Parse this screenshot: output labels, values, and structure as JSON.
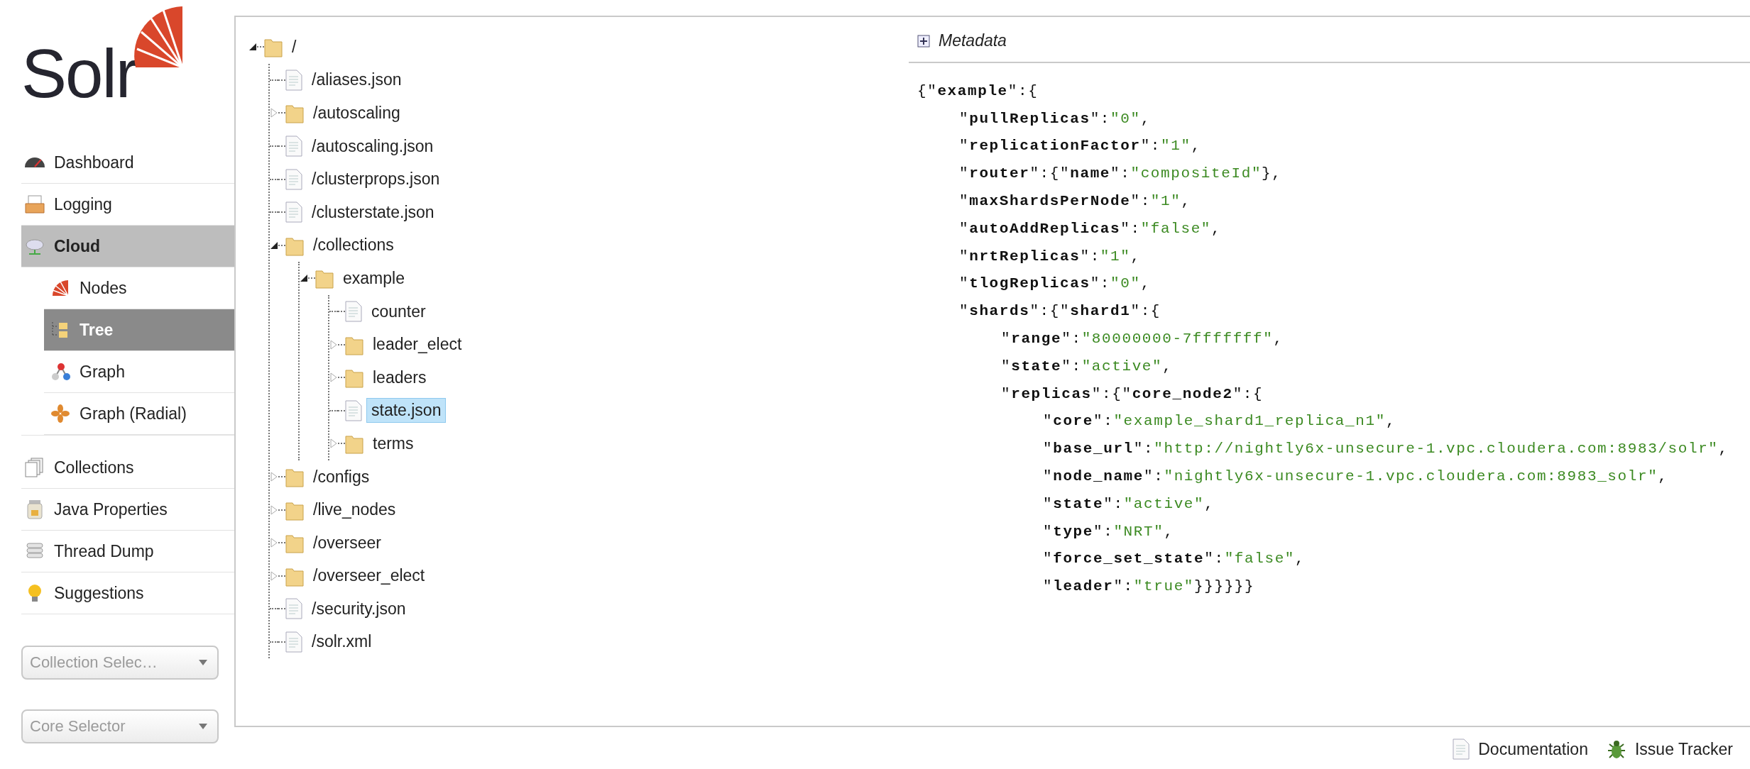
{
  "logo": {
    "text": "Solr"
  },
  "nav": [
    {
      "label": "Dashboard",
      "selected": false
    },
    {
      "label": "Logging",
      "selected": false
    },
    {
      "label": "Cloud",
      "selected": true,
      "children": [
        {
          "label": "Nodes",
          "selected": false
        },
        {
          "label": "Tree",
          "selected": true
        },
        {
          "label": "Graph",
          "selected": false
        },
        {
          "label": "Graph (Radial)",
          "selected": false
        }
      ]
    },
    {
      "label": "Collections",
      "selected": false
    },
    {
      "label": "Java Properties",
      "selected": false
    },
    {
      "label": "Thread Dump",
      "selected": false
    },
    {
      "label": "Suggestions",
      "selected": false
    }
  ],
  "selectors": [
    {
      "placeholder": "Collection Selec…"
    },
    {
      "placeholder": "Core Selector"
    }
  ],
  "tree": [
    {
      "label": "/",
      "kind": "folder",
      "expanded": true,
      "selected": false,
      "children": [
        {
          "label": "/aliases.json",
          "kind": "file",
          "selected": false
        },
        {
          "label": "/autoscaling",
          "kind": "folder",
          "expanded": false,
          "selected": false
        },
        {
          "label": "/autoscaling.json",
          "kind": "file",
          "selected": false
        },
        {
          "label": "/clusterprops.json",
          "kind": "file",
          "selected": false
        },
        {
          "label": "/clusterstate.json",
          "kind": "file",
          "selected": false
        },
        {
          "label": "/collections",
          "kind": "folder",
          "expanded": true,
          "selected": false,
          "children": [
            {
              "label": "example",
              "kind": "folder",
              "expanded": true,
              "selected": false,
              "children": [
                {
                  "label": "counter",
                  "kind": "file",
                  "selected": false
                },
                {
                  "label": "leader_elect",
                  "kind": "folder",
                  "expanded": false,
                  "selected": false
                },
                {
                  "label": "leaders",
                  "kind": "folder",
                  "expanded": false,
                  "selected": false
                },
                {
                  "label": "state.json",
                  "kind": "file",
                  "selected": true
                },
                {
                  "label": "terms",
                  "kind": "folder",
                  "expanded": false,
                  "selected": false
                }
              ]
            }
          ]
        },
        {
          "label": "/configs",
          "kind": "folder",
          "expanded": false,
          "selected": false
        },
        {
          "label": "/live_nodes",
          "kind": "folder",
          "expanded": false,
          "selected": false
        },
        {
          "label": "/overseer",
          "kind": "folder",
          "expanded": false,
          "selected": false
        },
        {
          "label": "/overseer_elect",
          "kind": "folder",
          "expanded": false,
          "selected": false
        },
        {
          "label": "/security.json",
          "kind": "file",
          "selected": false
        },
        {
          "label": "/solr.xml",
          "kind": "file",
          "selected": false
        }
      ]
    }
  ],
  "metadata": {
    "title": "Metadata",
    "expanded": false
  },
  "content": [
    {
      "tokens": [
        {
          "kind": "punct",
          "text": "{\""
        },
        {
          "kind": "key",
          "text": "example"
        },
        {
          "kind": "punct",
          "text": "\":{"
        }
      ],
      "children": [
        {
          "tokens": [
            {
              "kind": "punct",
              "text": "\""
            },
            {
              "kind": "key",
              "text": "pullReplicas"
            },
            {
              "kind": "punct",
              "text": "\":"
            },
            {
              "kind": "value",
              "text": "\"0\""
            },
            {
              "kind": "punct",
              "text": ","
            }
          ]
        },
        {
          "tokens": [
            {
              "kind": "punct",
              "text": "\""
            },
            {
              "kind": "key",
              "text": "replicationFactor"
            },
            {
              "kind": "punct",
              "text": "\":"
            },
            {
              "kind": "value",
              "text": "\"1\""
            },
            {
              "kind": "punct",
              "text": ","
            }
          ]
        },
        {
          "tokens": [
            {
              "kind": "punct",
              "text": "\""
            },
            {
              "kind": "key",
              "text": "router"
            },
            {
              "kind": "punct",
              "text": "\":{\""
            },
            {
              "kind": "key",
              "text": "name"
            },
            {
              "kind": "punct",
              "text": "\":"
            },
            {
              "kind": "value",
              "text": "\"compositeId\""
            },
            {
              "kind": "punct",
              "text": "},"
            }
          ]
        },
        {
          "tokens": [
            {
              "kind": "punct",
              "text": "\""
            },
            {
              "kind": "key",
              "text": "maxShardsPerNode"
            },
            {
              "kind": "punct",
              "text": "\":"
            },
            {
              "kind": "value",
              "text": "\"1\""
            },
            {
              "kind": "punct",
              "text": ","
            }
          ]
        },
        {
          "tokens": [
            {
              "kind": "punct",
              "text": "\""
            },
            {
              "kind": "key",
              "text": "autoAddReplicas"
            },
            {
              "kind": "punct",
              "text": "\":"
            },
            {
              "kind": "value",
              "text": "\"false\""
            },
            {
              "kind": "punct",
              "text": ","
            }
          ]
        },
        {
          "tokens": [
            {
              "kind": "punct",
              "text": "\""
            },
            {
              "kind": "key",
              "text": "nrtReplicas"
            },
            {
              "kind": "punct",
              "text": "\":"
            },
            {
              "kind": "value",
              "text": "\"1\""
            },
            {
              "kind": "punct",
              "text": ","
            }
          ]
        },
        {
          "tokens": [
            {
              "kind": "punct",
              "text": "\""
            },
            {
              "kind": "key",
              "text": "tlogReplicas"
            },
            {
              "kind": "punct",
              "text": "\":"
            },
            {
              "kind": "value",
              "text": "\"0\""
            },
            {
              "kind": "punct",
              "text": ","
            }
          ]
        },
        {
          "tokens": [
            {
              "kind": "punct",
              "text": "\""
            },
            {
              "kind": "key",
              "text": "shards"
            },
            {
              "kind": "punct",
              "text": "\":{\""
            },
            {
              "kind": "key",
              "text": "shard1"
            },
            {
              "kind": "punct",
              "text": "\":{"
            }
          ],
          "children": [
            {
              "tokens": [
                {
                  "kind": "punct",
                  "text": "\""
                },
                {
                  "kind": "key",
                  "text": "range"
                },
                {
                  "kind": "punct",
                  "text": "\":"
                },
                {
                  "kind": "value",
                  "text": "\"80000000-7fffffff\""
                },
                {
                  "kind": "punct",
                  "text": ","
                }
              ]
            },
            {
              "tokens": [
                {
                  "kind": "punct",
                  "text": "\""
                },
                {
                  "kind": "key",
                  "text": "state"
                },
                {
                  "kind": "punct",
                  "text": "\":"
                },
                {
                  "kind": "value",
                  "text": "\"active\""
                },
                {
                  "kind": "punct",
                  "text": ","
                }
              ]
            },
            {
              "tokens": [
                {
                  "kind": "punct",
                  "text": "\""
                },
                {
                  "kind": "key",
                  "text": "replicas"
                },
                {
                  "kind": "punct",
                  "text": "\":{\""
                },
                {
                  "kind": "key",
                  "text": "core_node2"
                },
                {
                  "kind": "punct",
                  "text": "\":{"
                }
              ],
              "children": [
                {
                  "tokens": [
                    {
                      "kind": "punct",
                      "text": "\""
                    },
                    {
                      "kind": "key",
                      "text": "core"
                    },
                    {
                      "kind": "punct",
                      "text": "\":"
                    },
                    {
                      "kind": "value",
                      "text": "\"example_shard1_replica_n1\""
                    },
                    {
                      "kind": "punct",
                      "text": ","
                    }
                  ]
                },
                {
                  "tokens": [
                    {
                      "kind": "punct",
                      "text": "\""
                    },
                    {
                      "kind": "key",
                      "text": "base_url"
                    },
                    {
                      "kind": "punct",
                      "text": "\":"
                    },
                    {
                      "kind": "value",
                      "text": "\"http://nightly6x-unsecure-1.vpc.cloudera.com:8983/solr\""
                    },
                    {
                      "kind": "punct",
                      "text": ","
                    }
                  ]
                },
                {
                  "tokens": [
                    {
                      "kind": "punct",
                      "text": "\""
                    },
                    {
                      "kind": "key",
                      "text": "node_name"
                    },
                    {
                      "kind": "punct",
                      "text": "\":"
                    },
                    {
                      "kind": "value",
                      "text": "\"nightly6x-unsecure-1.vpc.cloudera.com:8983_solr\""
                    },
                    {
                      "kind": "punct",
                      "text": ","
                    }
                  ]
                },
                {
                  "tokens": [
                    {
                      "kind": "punct",
                      "text": "\""
                    },
                    {
                      "kind": "key",
                      "text": "state"
                    },
                    {
                      "kind": "punct",
                      "text": "\":"
                    },
                    {
                      "kind": "value",
                      "text": "\"active\""
                    },
                    {
                      "kind": "punct",
                      "text": ","
                    }
                  ]
                },
                {
                  "tokens": [
                    {
                      "kind": "punct",
                      "text": "\""
                    },
                    {
                      "kind": "key",
                      "text": "type"
                    },
                    {
                      "kind": "punct",
                      "text": "\":"
                    },
                    {
                      "kind": "value",
                      "text": "\"NRT\""
                    },
                    {
                      "kind": "punct",
                      "text": ","
                    }
                  ]
                },
                {
                  "tokens": [
                    {
                      "kind": "punct",
                      "text": "\""
                    },
                    {
                      "kind": "key",
                      "text": "force_set_state"
                    },
                    {
                      "kind": "punct",
                      "text": "\":"
                    },
                    {
                      "kind": "value",
                      "text": "\"false\""
                    },
                    {
                      "kind": "punct",
                      "text": ","
                    }
                  ]
                },
                {
                  "tokens": [
                    {
                      "kind": "punct",
                      "text": "\""
                    },
                    {
                      "kind": "key",
                      "text": "leader"
                    },
                    {
                      "kind": "punct",
                      "text": "\":"
                    },
                    {
                      "kind": "value",
                      "text": "\"true\""
                    },
                    {
                      "kind": "punct",
                      "text": "}}}}}}"
                    }
                  ]
                }
              ]
            }
          ]
        }
      ]
    }
  ],
  "footer": [
    {
      "label": "Documentation"
    },
    {
      "label": "Issue Tracker"
    }
  ]
}
